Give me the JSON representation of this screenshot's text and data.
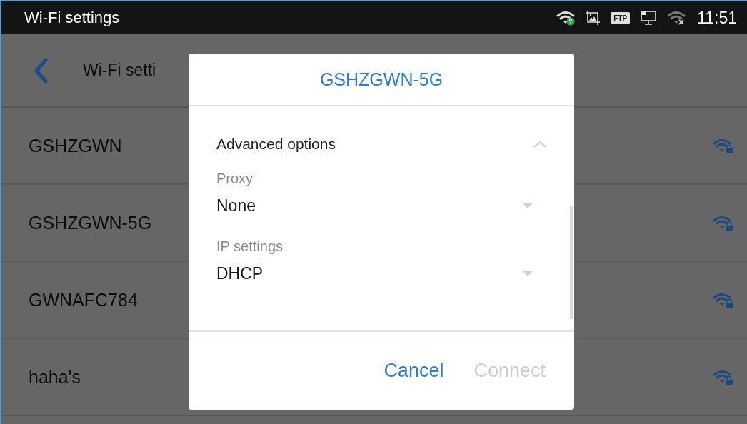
{
  "status_bar": {
    "title": "Wi-Fi settings",
    "ftp_badge": "FTP",
    "time": "11:51"
  },
  "header": {
    "title": "Wi-Fi setti"
  },
  "networks": [
    {
      "name": "GSHZGWN",
      "secured": true
    },
    {
      "name": "GSHZGWN-5G",
      "secured": true
    },
    {
      "name": "GWNAFC784",
      "secured": true
    },
    {
      "name": "haha's",
      "secured": true
    }
  ],
  "dialog": {
    "title": "GSHZGWN-5G",
    "advanced": {
      "label": "Advanced options",
      "expanded": true
    },
    "fields": [
      {
        "label": "Proxy",
        "value": "None"
      },
      {
        "label": "IP settings",
        "value": "DHCP"
      }
    ],
    "buttons": [
      {
        "label": "Cancel",
        "disabled": false
      },
      {
        "label": "Connect",
        "disabled": true
      }
    ]
  }
}
